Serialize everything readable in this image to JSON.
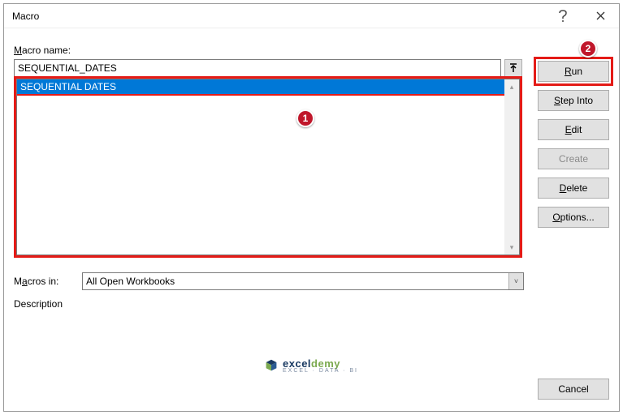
{
  "titlebar": {
    "title": "Macro"
  },
  "labels": {
    "macro_name": "Macro name:",
    "macros_in": "Macros in:",
    "description": "Description"
  },
  "macro_name_value": "SEQUENTIAL_DATES",
  "list": {
    "items": [
      "SEQUENTIAL DATES"
    ],
    "selected_index": 0
  },
  "macros_in_value": "All Open Workbooks",
  "buttons": {
    "run": "Run",
    "step_into": "Step Into",
    "edit": "Edit",
    "create": "Create",
    "delete": "Delete",
    "options": "Options...",
    "cancel": "Cancel"
  },
  "annotations": {
    "badge1": "1",
    "badge2": "2"
  },
  "footer": {
    "brand_a": "excel",
    "brand_b": "demy",
    "sub": "EXCEL · DATA · BI"
  }
}
